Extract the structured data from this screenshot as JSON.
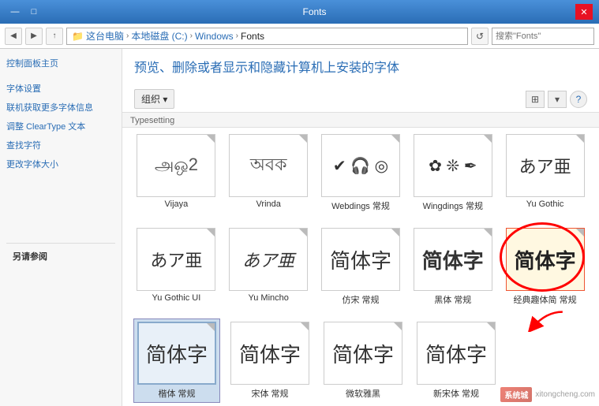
{
  "window": {
    "title": "Fonts",
    "controls": {
      "minimize": "—",
      "maximize": "□",
      "close": "✕"
    }
  },
  "addressbar": {
    "back": "◀",
    "forward": "▶",
    "up": "↑",
    "folder_icon": "📁",
    "path_parts": [
      "这台电脑",
      "本地磁盘 (C:)",
      "Windows",
      "Fonts"
    ],
    "refresh": "↺",
    "search_placeholder": "搜索\"Fonts\""
  },
  "sidebar": {
    "main_link": "控制面板主页",
    "links": [
      "字体设置",
      "联机获取更多字体信息",
      "调整 ClearType 文本",
      "查找字符",
      "更改字体大小"
    ],
    "also_see": "另请参阅"
  },
  "content": {
    "title": "预览、删除或者显示和隐藏计算机上安装的字体",
    "organize_label": "组织 ▾",
    "section_label": "Typesetting",
    "fonts": [
      {
        "name": "Vijaya",
        "preview_text": "அஒ2",
        "style": "page"
      },
      {
        "name": "Vrinda",
        "preview_text": "অবক",
        "style": "page"
      },
      {
        "name": "Webdings 常规",
        "preview_text": "✔ 🎧 ◎",
        "style": "page"
      },
      {
        "name": "Wingdings 常规",
        "preview_text": "✿ ✲ ✒",
        "style": "page"
      },
      {
        "name": "Yu Gothic",
        "preview_text": "あ ア 亜",
        "style": "page"
      }
    ],
    "fonts_row2": [
      {
        "name": "Yu Gothic UI",
        "preview_text": "あ ア 亜",
        "style": "page"
      },
      {
        "name": "Yu Mincho",
        "preview_text": "あ ア 亜",
        "style": "page"
      },
      {
        "name": "仿宋 常规",
        "preview_text": "简体字",
        "style": "page"
      },
      {
        "name": "黑体 常规",
        "preview_text": "简体字",
        "style": "page"
      },
      {
        "name": "经典趣体简 常规",
        "preview_text": "简体字",
        "style": "page",
        "highlighted": true
      }
    ],
    "fonts_row3": [
      {
        "name": "楷体 常规",
        "preview_text": "简体字",
        "style": "page"
      },
      {
        "name": "宋体 常规",
        "preview_text": "简体字",
        "style": "page"
      },
      {
        "name": "微软雅黑",
        "preview_text": "简体字",
        "style": "page"
      },
      {
        "name": "新宋体 常规",
        "preview_text": "简体字",
        "style": "page"
      }
    ]
  },
  "watermark": {
    "site": "xitongcheng.com",
    "logo": "系"
  }
}
